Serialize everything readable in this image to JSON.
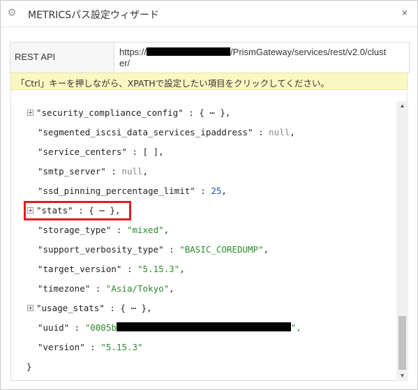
{
  "dialog": {
    "title": "METRICSパス設定ウィザード",
    "close_label": "×",
    "icon": "gear-icon"
  },
  "rest_api": {
    "label": "REST API",
    "url_prefix": "https://",
    "url_suffix": "/PrismGateway/services/rest/v2.0/clust",
    "url_wrap": "er/"
  },
  "hint": {
    "text": "「Ctrl」キーを押しながら、XPATHで設定したい項目をクリックしてください。"
  },
  "code": {
    "lines": [
      {
        "key": "\"security_compliance_config\"",
        "sep": " : ",
        "value": "{ ⋯ },",
        "expandable": true
      },
      {
        "key": "\"segmented_iscsi_data_services_ipaddress\"",
        "sep": " : ",
        "value": "null",
        "value_end": ",",
        "vtype": "null"
      },
      {
        "key": "\"service_centers\"",
        "sep": " : ",
        "value": "[ ],"
      },
      {
        "key": "\"smtp_server\"",
        "sep": " : ",
        "value": "null",
        "value_end": ",",
        "vtype": "null"
      },
      {
        "key": "\"ssd_pinning_percentage_limit\"",
        "sep": " : ",
        "value": "25",
        "value_end": ",",
        "vtype": "num"
      },
      {
        "key": "\"stats\"",
        "sep": " : ",
        "value": "{ ⋯ },",
        "expandable": true
      },
      {
        "key": "\"storage_type\"",
        "sep": " : ",
        "value": "\"mixed\"",
        "value_end": ",",
        "vtype": "str"
      },
      {
        "key": "\"support_verbosity_type\"",
        "sep": " : ",
        "value": "\"BASIC_COREDUMP\"",
        "value_end": ",",
        "vtype": "str"
      },
      {
        "key": "\"target_version\"",
        "sep": " : ",
        "value": "\"5.15.3\"",
        "value_end": ",",
        "vtype": "str"
      },
      {
        "key": "\"timezone\"",
        "sep": " : ",
        "value": "\"Asia/Tokyo\"",
        "value_end": ",",
        "vtype": "str"
      },
      {
        "key": "\"usage_stats\"",
        "sep": " : ",
        "value": "{ ⋯ },",
        "expandable": true
      },
      {
        "key": "\"uuid\"",
        "sep": " : ",
        "value": "\"0005b",
        "value_end": "\",",
        "vtype": "str",
        "redacted": true
      },
      {
        "key": "\"version\"",
        "sep": " : ",
        "value": "\"5.15.3\"",
        "value_end": "",
        "vtype": "str"
      }
    ],
    "closing_brace": "}"
  },
  "selected_key": "\"stats\""
}
